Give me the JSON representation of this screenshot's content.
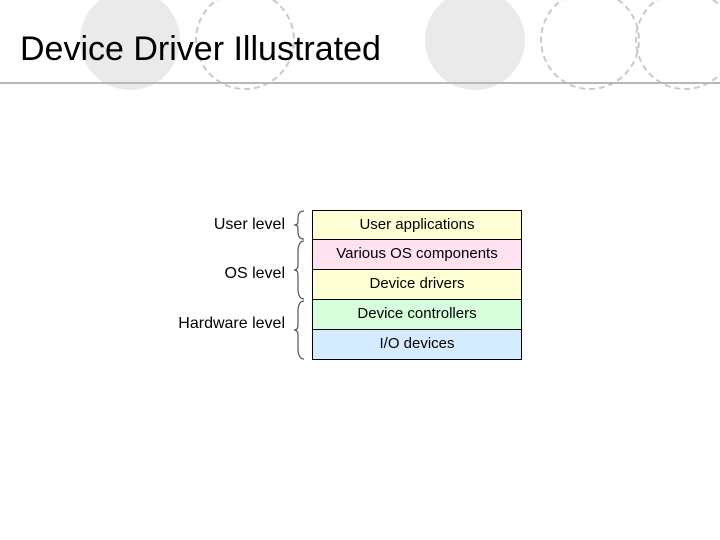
{
  "title": "Device Driver Illustrated",
  "levels": {
    "user": "User level",
    "os": "OS level",
    "hardware": "Hardware level"
  },
  "boxes": {
    "user_applications": "User applications",
    "os_components": "Various OS components",
    "device_drivers": "Device drivers",
    "device_controllers": "Device controllers",
    "io_devices": "I/O devices"
  },
  "colors": {
    "yellow": "#feffd4",
    "pink": "#ffe1f0",
    "green": "#d8ffdc",
    "blue": "#d5ebff",
    "grey_circle": "#eaeaea",
    "dash_circle": "#c9c9c9",
    "underline": "#b8b8b8"
  }
}
